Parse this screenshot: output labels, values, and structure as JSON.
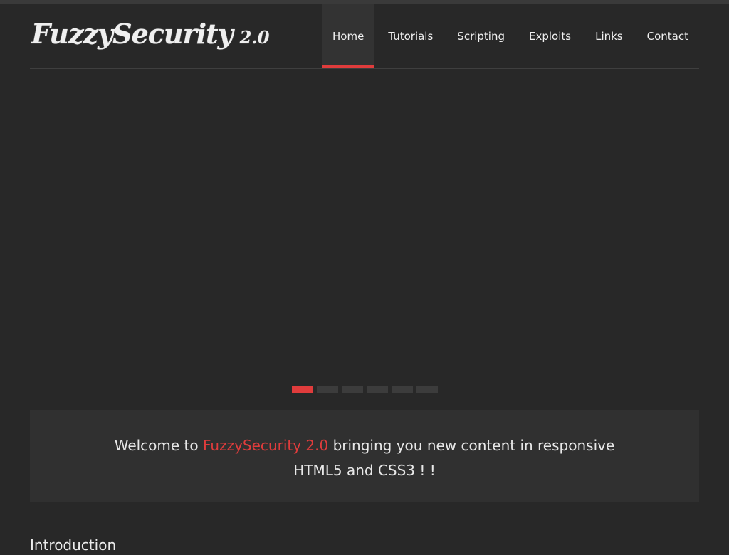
{
  "colors": {
    "background": "#282828",
    "accent": "#e03c3c",
    "panel": "#303030"
  },
  "logo": {
    "name": "FuzzySecurity",
    "version": "2.0"
  },
  "nav": {
    "items": [
      {
        "label": "Home",
        "active": true
      },
      {
        "label": "Tutorials",
        "active": false
      },
      {
        "label": "Scripting",
        "active": false
      },
      {
        "label": "Exploits",
        "active": false
      },
      {
        "label": "Links",
        "active": false
      },
      {
        "label": "Contact",
        "active": false
      }
    ]
  },
  "slider": {
    "slide_count": 6,
    "active_slide": 1
  },
  "welcome": {
    "prefix": "Welcome to ",
    "highlight": "FuzzySecurity 2.0",
    "suffix": " bringing you new content in responsive HTML5 and CSS3 ! !"
  },
  "intro": {
    "heading": "Introduction"
  }
}
